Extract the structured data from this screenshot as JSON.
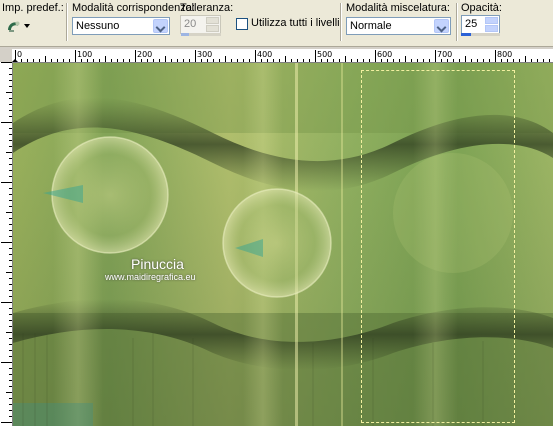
{
  "toolbar": {
    "preset_label": "Imp. predef.:",
    "match_mode_label": "Modalità corrispondenza:",
    "match_mode_value": "Nessuno",
    "tolerance_label": "Tolleranza:",
    "tolerance_value": "20",
    "use_all_layers_label": "Utilizza tutti i livelli",
    "use_all_layers_checked": false,
    "blend_mode_label": "Modalità miscelatura:",
    "blend_mode_value": "Normale",
    "opacity_label": "Opacità:",
    "opacity_value": "25",
    "opacity_fraction": 0.25,
    "tolerance_fraction": 0.2
  },
  "ruler": {
    "ticks": [
      "0",
      "100",
      "200",
      "300",
      "400",
      "500",
      "600",
      "700",
      "800"
    ]
  },
  "canvas": {
    "watermark_title": "Pinuccia",
    "watermark_url": "www.maidiregrafica.eu"
  },
  "colors": {
    "accent": "#2a61d6",
    "selection": "#f3f0a0",
    "canvas_base": "#9fb65f"
  }
}
